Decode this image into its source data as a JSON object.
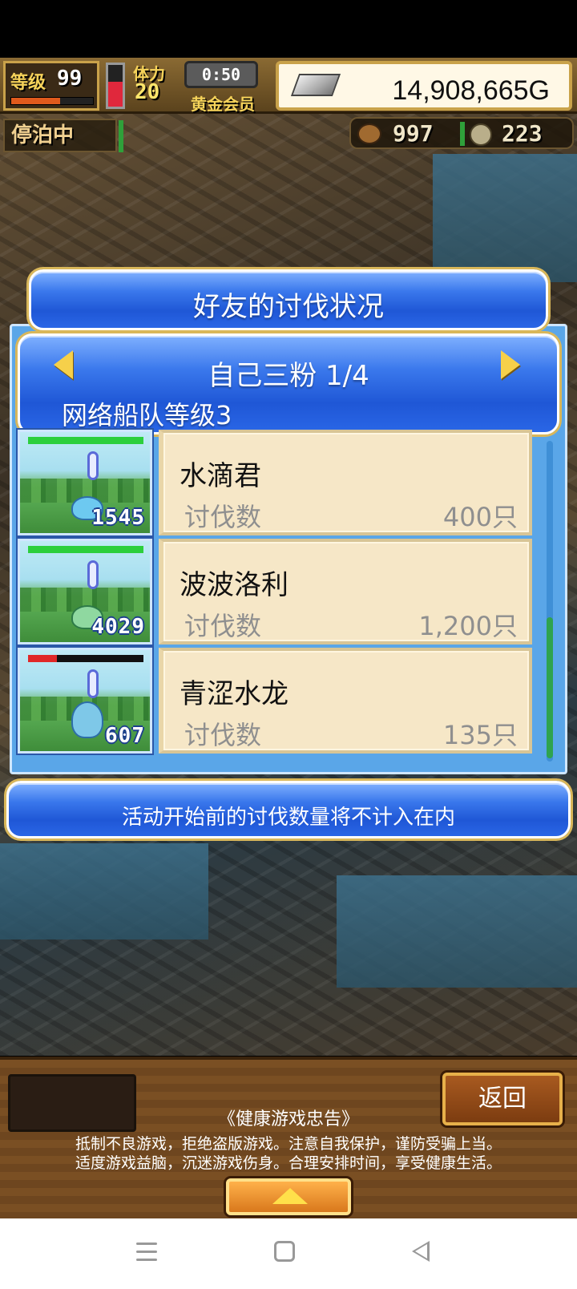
{
  "hud": {
    "level_label": "等级",
    "level_value": "99",
    "level_progress": 0.6,
    "stamina_label": "体力",
    "stamina_value": "20",
    "stamina_fill": 0.6,
    "timer": "0:50",
    "membership": "黄金会员",
    "gold": "14,908,665G",
    "dock_status": "停泊中",
    "resource_a": "997",
    "resource_b": "223"
  },
  "dialog": {
    "title": "好友的讨伐状况",
    "friend_name": "自己三粉 1/4",
    "fleet_level": "网络船队等级3",
    "notice": "活动开始前的讨伐数量将不计入在内"
  },
  "monsters": [
    {
      "name": "水滴君",
      "kill_label": "讨伐数",
      "kill_count": "400只",
      "level": "1545",
      "hp": 1.0,
      "hp_color": "#2ccf3c"
    },
    {
      "name": "波波洛利",
      "kill_label": "讨伐数",
      "kill_count": "1,200只",
      "level": "4029",
      "hp": 1.0,
      "hp_color": "#2ccf3c"
    },
    {
      "name": "青涩水龙",
      "kill_label": "讨伐数",
      "kill_count": "135只",
      "level": "607",
      "hp": 0.25,
      "hp_color": "#e02828"
    }
  ],
  "bottom": {
    "back_label": "返回",
    "health_title": "《健康游戏忠告》",
    "health_line1": "抵制不良游戏，拒绝盗版游戏。注意自我保护，谨防受骗上当。",
    "health_line2": "适度游戏益脑，沉迷游戏伤身。合理安排时间，享受健康生活。"
  },
  "colors": {
    "panel_blue": "#2a66e6",
    "card_bg": "#f6e7c7",
    "gold_text": "#f6d35a"
  }
}
